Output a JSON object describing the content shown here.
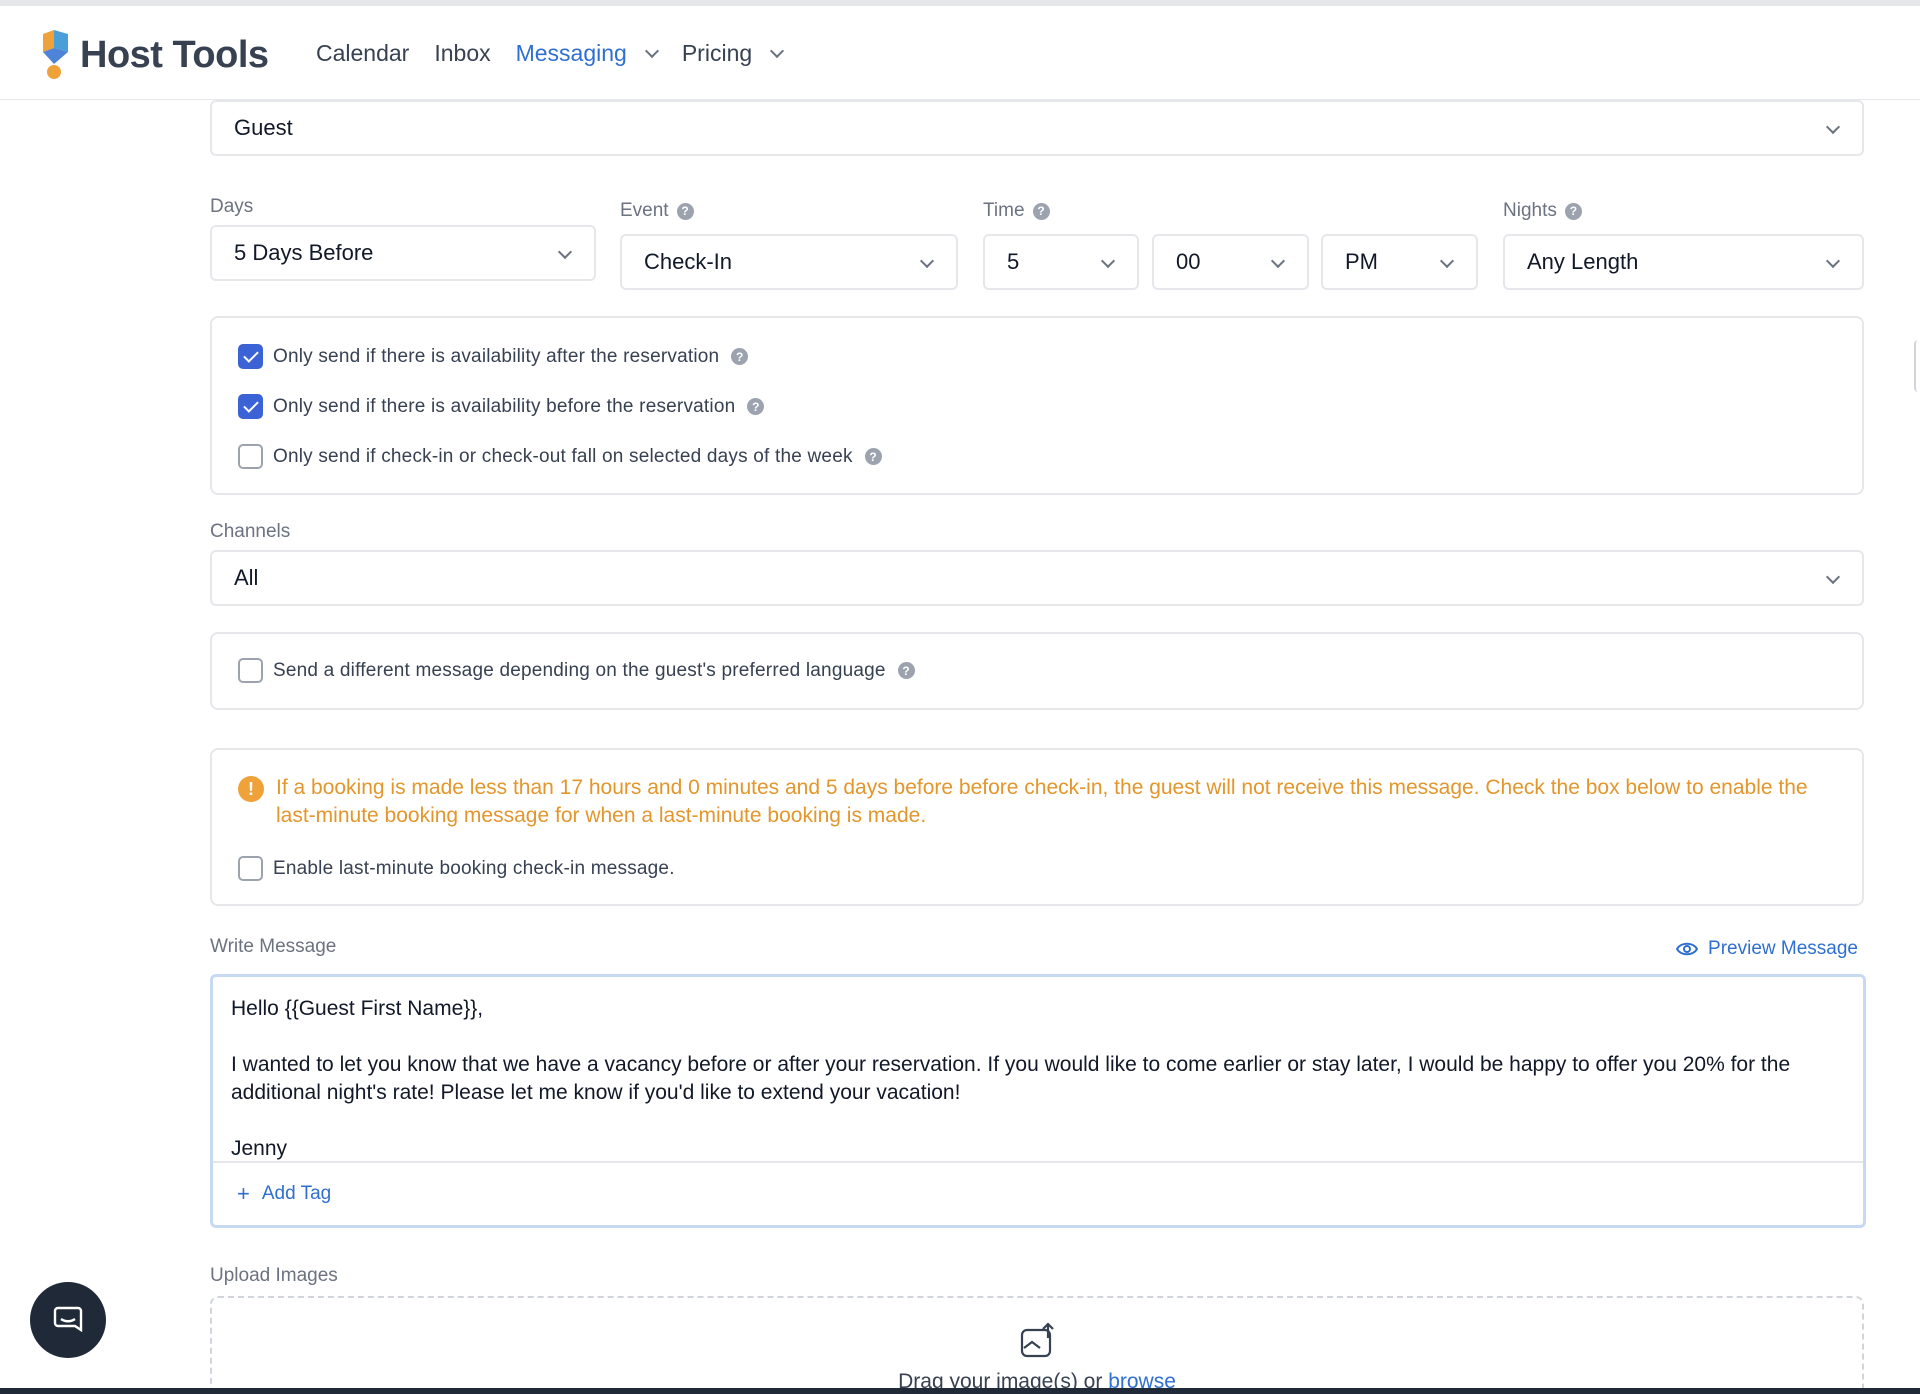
{
  "app": {
    "name": "Host Tools",
    "nav": [
      {
        "label": "Calendar",
        "active": false,
        "dropdown": false
      },
      {
        "label": "Inbox",
        "active": false,
        "dropdown": false
      },
      {
        "label": "Messaging",
        "active": true,
        "dropdown": true
      },
      {
        "label": "Pricing",
        "active": false,
        "dropdown": true
      }
    ]
  },
  "form": {
    "recipient": {
      "value": "Guest"
    },
    "days": {
      "label": "Days",
      "value": "5 Days Before"
    },
    "event": {
      "label": "Event",
      "value": "Check-In"
    },
    "time": {
      "label": "Time",
      "hour": "5",
      "minute": "00",
      "ampm": "PM"
    },
    "nights": {
      "label": "Nights",
      "value": "Any Length"
    },
    "conditions": [
      {
        "label": "Only send if there is availability after the reservation",
        "checked": true
      },
      {
        "label": "Only send if there is availability before the reservation",
        "checked": true
      },
      {
        "label": "Only send if check-in or check-out fall on selected days of the week",
        "checked": false
      }
    ],
    "channels": {
      "label": "Channels",
      "value": "All"
    },
    "language_option": {
      "label": "Send a different message depending on the guest's preferred language",
      "checked": false
    },
    "warning": {
      "text": "If a booking is made less than 17 hours and 0 minutes and 5 days before before check-in, the guest will not receive this message. Check the box below to enable the last-minute booking message for when a last-minute booking is made.",
      "checkbox_label": "Enable last-minute booking check-in message.",
      "checked": false
    },
    "message": {
      "label": "Write Message",
      "preview_label": "Preview Message",
      "lines": [
        "Hello {{Guest First Name}},",
        "",
        "I wanted to let you know that we have a vacancy before or after your reservation. If you would like to come earlier or stay later, I would be happy to offer you 20% for the additional night's rate! Please let me know if you'd like to extend your vacation!",
        "",
        "Jenny"
      ],
      "add_tag_label": "Add Tag"
    },
    "upload": {
      "label": "Upload Images",
      "drag_text": "Drag your image(s) or",
      "browse_text": "browse"
    }
  },
  "colors": {
    "accent": "#2f6fd1",
    "checkbox": "#3b63d6",
    "warning": "#e3962b"
  },
  "icons": {
    "help": "question-circle",
    "warning": "exclamation-circle",
    "preview": "eye",
    "add": "plus",
    "upload": "image-upload",
    "chat": "chat-bubble"
  }
}
